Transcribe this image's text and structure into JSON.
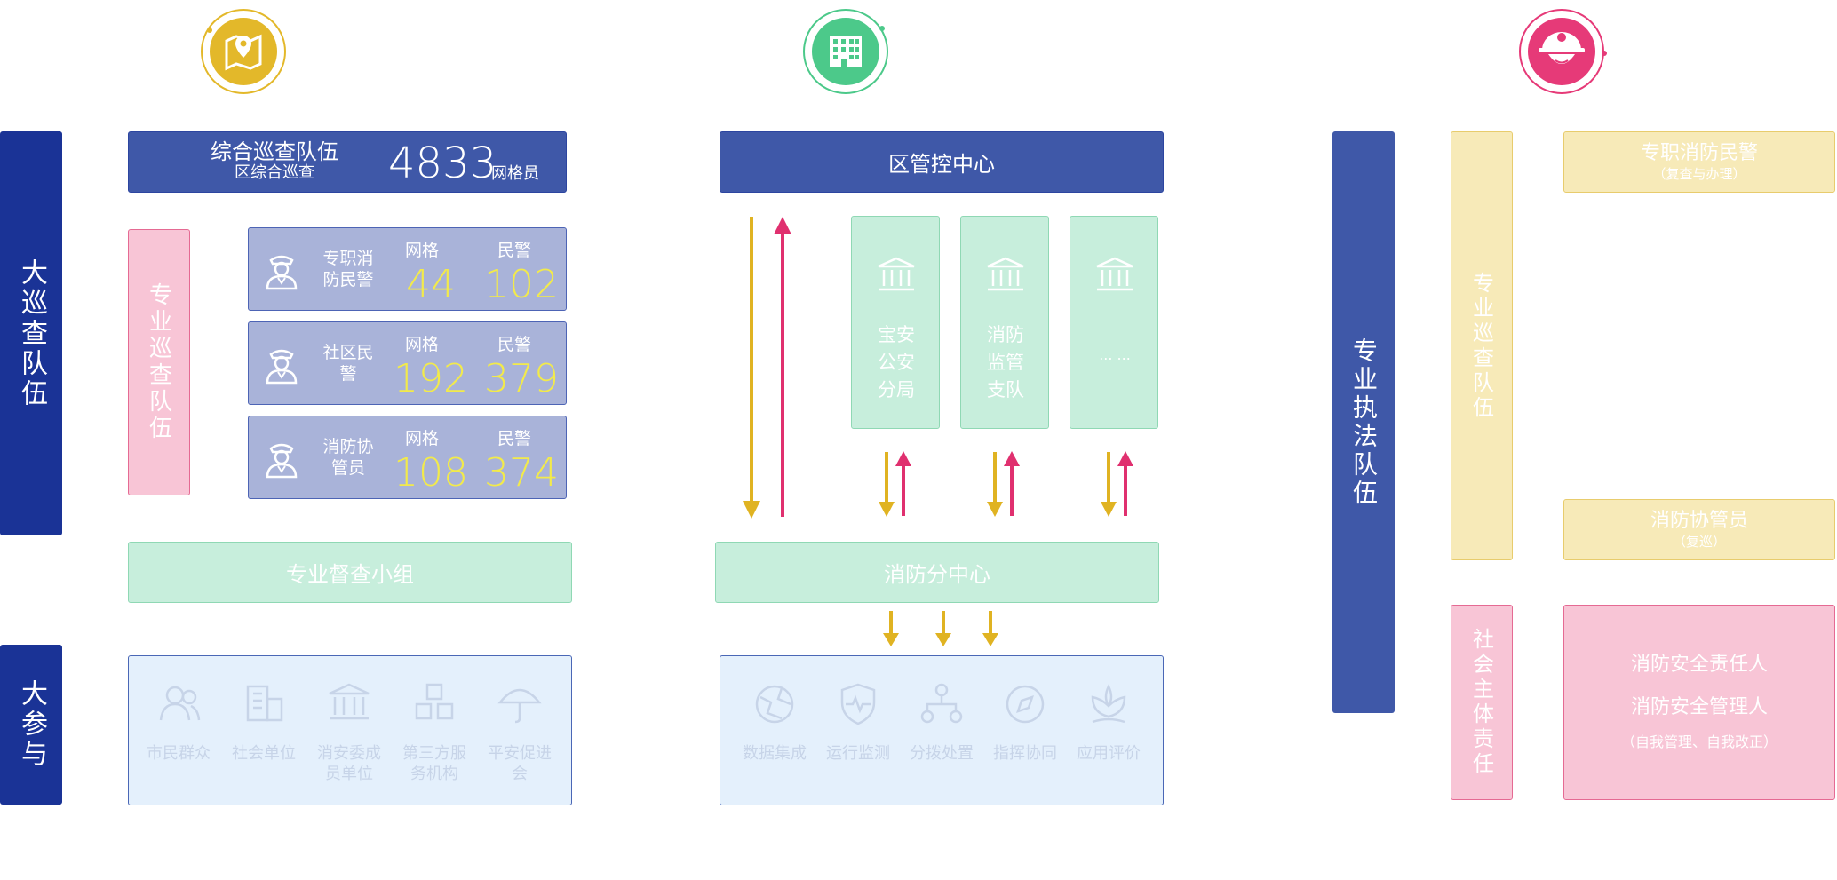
{
  "colors": {
    "dark_blue": "#1a3396",
    "blue": "#3f58a8",
    "pink": "#f8c5d6",
    "green": "#c7eedc",
    "yellow": "#f7eab8",
    "arrow_yellow": "#e0b322",
    "arrow_pink": "#e0306f"
  },
  "top_icons": [
    "map-pin-icon",
    "building-icon",
    "firefighter-helmet-icon"
  ],
  "left": {
    "da_xuncha": "大巡查队伍",
    "da_canyu": "大参与",
    "zonghe": {
      "title": "综合巡查队伍",
      "subtitle": "区综合巡查",
      "count": "4833",
      "unit": "网格员"
    },
    "zhuanye_xuncha": "专业巡查队伍",
    "cards": [
      {
        "name": "专职消防民警",
        "grid_label": "网格",
        "grid_value": "44",
        "police_label": "民警",
        "police_value": "102"
      },
      {
        "name": "社区民警",
        "grid_label": "网格",
        "grid_value": "192",
        "police_label": "民警",
        "police_value": "379"
      },
      {
        "name": "消防协管员",
        "grid_label": "网格",
        "grid_value": "108",
        "police_label": "民警",
        "police_value": "374"
      }
    ],
    "dudu": "专业督查小组",
    "participants": [
      {
        "icon": "people-icon",
        "label": "市民群众"
      },
      {
        "icon": "company-icon",
        "label": "社会单位"
      },
      {
        "icon": "bank-icon",
        "label": "消安委成员单位"
      },
      {
        "icon": "blocks-icon",
        "label": "第三方服务机构"
      },
      {
        "icon": "umbrella-icon",
        "label": "平安促进会"
      }
    ]
  },
  "middle": {
    "center": "区管控中心",
    "units": [
      "宝安公安分局",
      "消防监管支队",
      "... ..."
    ],
    "sub_center": "消防分中心",
    "functions": [
      {
        "icon": "globe-icon",
        "label": "数据集成"
      },
      {
        "icon": "shield-pulse-icon",
        "label": "运行监测"
      },
      {
        "icon": "network-icon",
        "label": "分拨处置"
      },
      {
        "icon": "compass-icon",
        "label": "指挥协同"
      },
      {
        "icon": "lotus-icon",
        "label": "应用评价"
      }
    ]
  },
  "right": {
    "zhifa": "专业执法队伍",
    "zhuanye_xuncha": "专业巡查队伍",
    "minjing": {
      "title": "专职消防民警",
      "sub": "（复查与办理）"
    },
    "xieguan": {
      "title": "消防协管员",
      "sub": "（复巡）"
    },
    "shehui": "社会主体责任",
    "zeren": {
      "line1": "消防安全责任人",
      "line2": "消防安全管理人",
      "line3": "（自我管理、自我改正）"
    }
  }
}
